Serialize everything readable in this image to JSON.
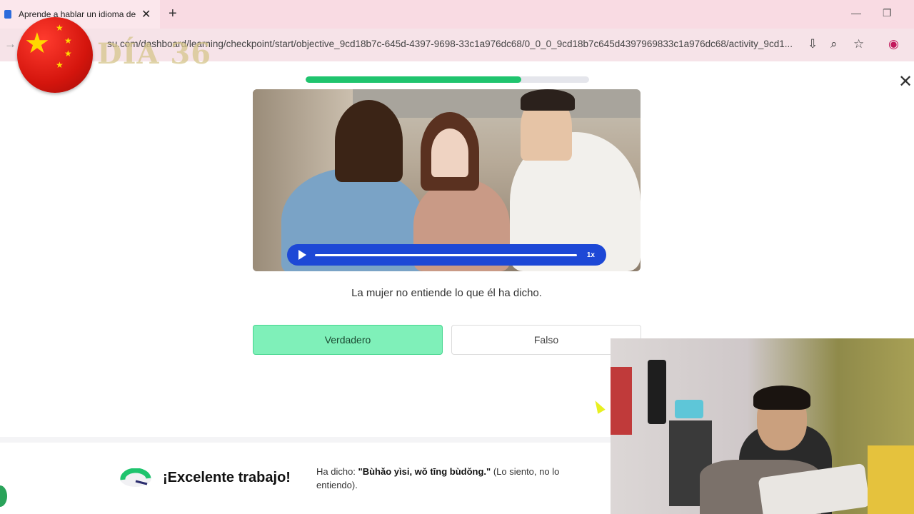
{
  "browser": {
    "tab_title": "Aprende a hablar un idioma de",
    "url": "su.com/dashboard/learning/checkpoint/start/objective_9cd18b7c-645d-4397-9698-33c1a976dc68/0_0_0_9cd18b7c645d4397969833c1a976dc68/activity_9cd1..."
  },
  "overlay": {
    "day_label": "DÍA 36"
  },
  "lesson": {
    "progress_fraction": 0.76,
    "audio_speed": "1x",
    "question": "La mujer no entiende lo que él ha dicho.",
    "options": {
      "true_label": "Verdadero",
      "false_label": "Falso"
    }
  },
  "feedback": {
    "title": "¡Excelente trabajo!",
    "prefix": "Ha dicho: ",
    "phrase": "\"Bùhǎo yìsi, wǒ tīng bùdǒng.\"",
    "translation": " (Lo siento, no lo entiendo)."
  },
  "colors": {
    "accent_green": "#1fc46e",
    "audio_blue": "#1d48d6",
    "selected_bg": "#7ff0b9"
  }
}
